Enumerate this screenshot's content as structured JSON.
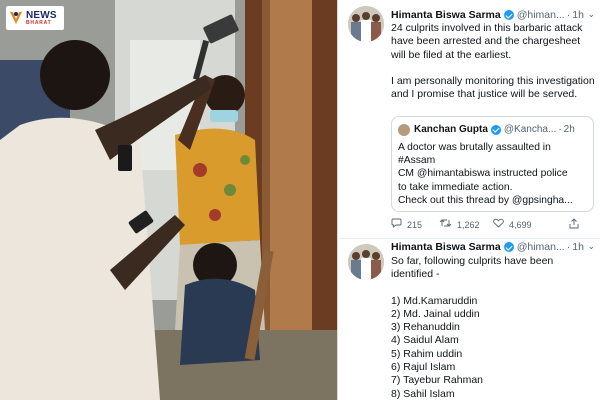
{
  "logo": {
    "line1": "NEWS",
    "line2": "BHARAT"
  },
  "tweet1": {
    "name": "Himanta Biswa Sarma",
    "handle": "@himan...",
    "time": "1h",
    "para1": "24 culprits involved in this barbaric attack have been arrested and the chargesheet will be filed at the earliest.",
    "para2": "I am personally monitoring this investigation and I promise that justice will be served.",
    "quote": {
      "name": "Kanchan Gupta",
      "handle": "@Kancha...",
      "time": "2h",
      "lines": [
        "A doctor was brutally assaulted in",
        "#Assam",
        "CM @himantabiswa instructed police",
        "to take immediate action.",
        "Check out this thread by @gpsingha..."
      ]
    },
    "stats": {
      "replies": "215",
      "retweets": "1,262",
      "likes": "4,699"
    },
    "icons": [
      "reply-icon",
      "retweet-icon",
      "like-icon",
      "share-icon"
    ]
  },
  "tweet2": {
    "name": "Himanta Biswa Sarma",
    "handle": "@himan...",
    "time": "1h",
    "intro": "So far, following culprits have been identified -",
    "culprits": [
      "1) Md.Kamaruddin",
      "2) Md. Jainal uddin",
      "3) Rehanuddin",
      "4) Saidul Alam",
      "5) Rahim uddin",
      "6) Rajul Islam",
      "7) Tayebur Rahman",
      "8) Sahil Islam"
    ]
  },
  "colors": {
    "verified": "#1d9bf0",
    "text": "#0f1419",
    "muted": "#536471",
    "border": "#cfd9de"
  }
}
